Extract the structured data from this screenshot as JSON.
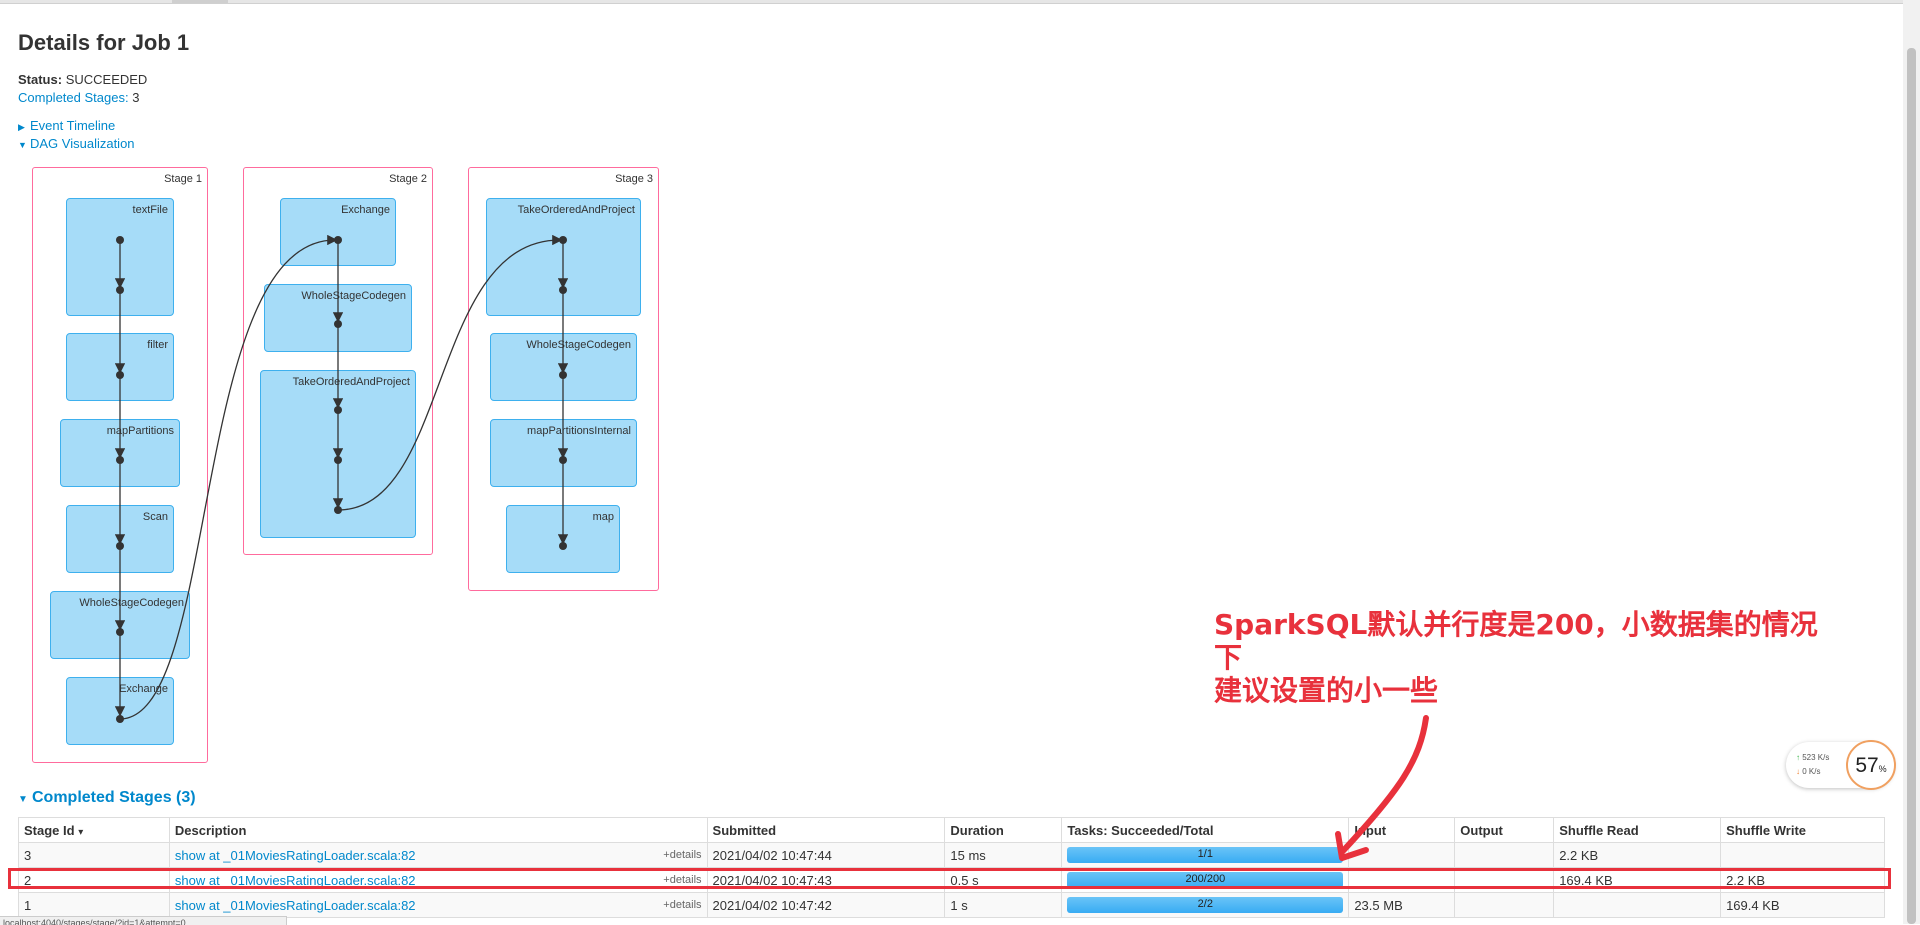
{
  "page": {
    "title": "Details for Job 1",
    "status_label": "Status:",
    "status_value": "SUCCEEDED",
    "completed_stages_label": "Completed Stages:",
    "completed_stages_value": "3",
    "event_timeline_label": "Event Timeline",
    "dag_label": "DAG Visualization"
  },
  "dag": {
    "stages": [
      {
        "label": "Stage 1",
        "ops": [
          "textFile",
          "filter",
          "mapPartitions",
          "Scan",
          "WholeStageCodegen",
          "Exchange"
        ]
      },
      {
        "label": "Stage 2",
        "ops": [
          "Exchange",
          "WholeStageCodegen",
          "TakeOrderedAndProject"
        ]
      },
      {
        "label": "Stage 3",
        "ops": [
          "TakeOrderedAndProject",
          "WholeStageCodegen",
          "mapPartitionsInternal",
          "map"
        ]
      }
    ]
  },
  "annotation": {
    "line1": "SparkSQL默认并行度是200，小数据集的情况下",
    "line2": "建议设置的小一些"
  },
  "speed_widget": {
    "up": "523 K/s",
    "down": "0   K/s",
    "percent": "57",
    "percent_unit": "%"
  },
  "completed_section": {
    "title": "Completed Stages (3)",
    "columns": [
      "Stage Id",
      "Description",
      "Submitted",
      "Duration",
      "Tasks: Succeeded/Total",
      "Input",
      "Output",
      "Shuffle Read",
      "Shuffle Write"
    ],
    "sort_indicator": "▾",
    "details_label": "+details",
    "rows": [
      {
        "id": "3",
        "description": "show at _01MoviesRatingLoader.scala:82",
        "submitted": "2021/04/02 10:47:44",
        "duration": "15 ms",
        "tasks": "1/1",
        "tasks_fraction": 1.0,
        "input": "",
        "output": "",
        "shuffle_read": "2.2 KB",
        "shuffle_write": ""
      },
      {
        "id": "2",
        "description": "show at _01MoviesRatingLoader.scala:82",
        "submitted": "2021/04/02 10:47:43",
        "duration": "0.5 s",
        "tasks": "200/200",
        "tasks_fraction": 1.0,
        "input": "",
        "output": "",
        "shuffle_read": "169.4 KB",
        "shuffle_write": "2.2 KB"
      },
      {
        "id": "1",
        "description": "show at _01MoviesRatingLoader.scala:82",
        "submitted": "2021/04/02 10:47:42",
        "duration": "1 s",
        "tasks": "2/2",
        "tasks_fraction": 1.0,
        "input": "23.5 MB",
        "output": "",
        "shuffle_read": "",
        "shuffle_write": "169.4 KB"
      }
    ]
  },
  "statusbar": {
    "text": "localhost:4040/stages/stage/?id=1&attempt=0"
  },
  "colors": {
    "link": "#0088cc",
    "annotation": "#e8313c",
    "op_fill": "#a6dcf8",
    "cluster_border": "#ff6b9d"
  }
}
